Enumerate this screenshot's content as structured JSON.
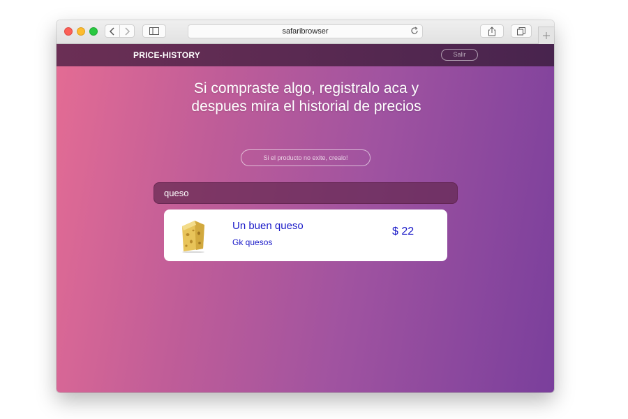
{
  "browser": {
    "url": "safaribrowser",
    "icons": [
      "back-icon",
      "forward-icon",
      "sidebar-icon",
      "reload-icon",
      "share-icon",
      "tabs-icon",
      "plus-icon"
    ]
  },
  "navbar": {
    "brand": "PRICE-HISTORY",
    "logout_label": "Salir"
  },
  "hero": {
    "line1": "Si compraste algo, registralo aca y",
    "line2": "despues mira el historial de precios",
    "create_label": "Si el producto no exite, crealo!"
  },
  "search": {
    "value": "queso"
  },
  "results": [
    {
      "name": "Un buen queso",
      "shop": "Gk quesos",
      "price": "$ 22",
      "icon": "cheese-icon"
    }
  ],
  "colors": {
    "gradient_start": "#e46c94",
    "gradient_end": "#7a3f9c",
    "navbar": "#5a2a52",
    "link": "#1a1ac8"
  }
}
